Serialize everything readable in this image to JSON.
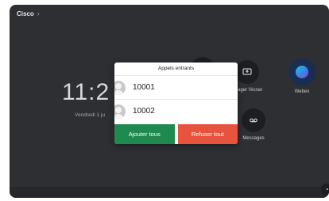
{
  "brand": {
    "name": "Cisco"
  },
  "home": {
    "time_partial": "11:2",
    "date_partial": "Vendredi 1 ju"
  },
  "tiles": {
    "share_screen": {
      "label": "artager l'écran"
    },
    "webex": {
      "label": "Webex"
    },
    "messages": {
      "label": "Messages"
    }
  },
  "modal": {
    "title": "Appels entrants",
    "calls": [
      {
        "number": "10001"
      },
      {
        "number": "10002"
      }
    ],
    "accept_all_label": "Ajouter tous",
    "decline_all_label": "Refuser tout"
  },
  "colors": {
    "accept": "#1f8a4f",
    "decline": "#e8533e",
    "background": "#2e2f33"
  }
}
